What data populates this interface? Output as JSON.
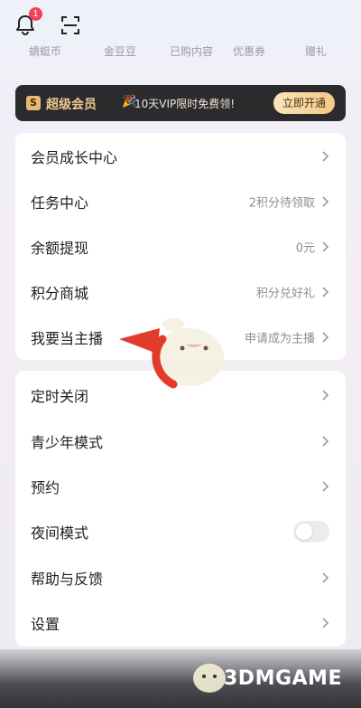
{
  "notifications": {
    "count": "1"
  },
  "quick_links": [
    {
      "label": "蜻蜓币"
    },
    {
      "label": "金豆豆"
    },
    {
      "label": "已购内容"
    },
    {
      "label": "优惠券"
    },
    {
      "label": "赠礼"
    }
  ],
  "vip_banner": {
    "icon_letter": "S",
    "title": "超级会员",
    "promo": "10天VIP限时免费领!",
    "button": "立即开通"
  },
  "menu_group_1": [
    {
      "label": "会员成长中心",
      "value": ""
    },
    {
      "label": "任务中心",
      "value": "2积分待领取"
    },
    {
      "label": "余额提现",
      "value": "0元"
    },
    {
      "label": "积分商城",
      "value": "积分兑好礼"
    },
    {
      "label": "我要当主播",
      "value": "申请成为主播"
    }
  ],
  "menu_group_2": [
    {
      "label": "定时关闭",
      "type": "link"
    },
    {
      "label": "青少年模式",
      "type": "link"
    },
    {
      "label": "预约",
      "type": "link"
    },
    {
      "label": "夜间模式",
      "type": "toggle",
      "on": false
    },
    {
      "label": "帮助与反馈",
      "type": "link"
    },
    {
      "label": "设置",
      "type": "link"
    }
  ],
  "watermark": {
    "text": "3DMGAME"
  },
  "colors": {
    "accent": "#f0435a",
    "vip_gold": "#f0c98e",
    "arrow": "#e23b2a"
  }
}
